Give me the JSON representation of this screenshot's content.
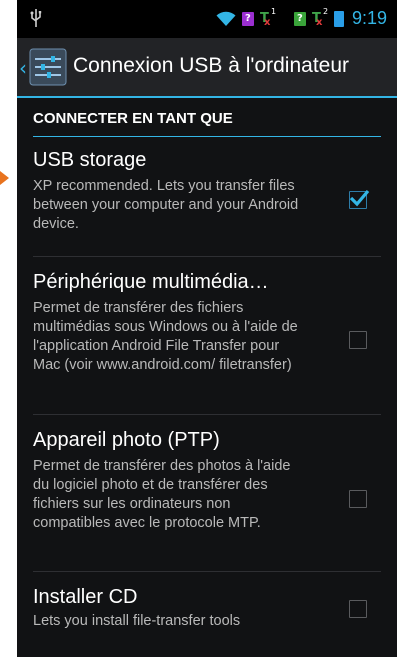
{
  "statusbar": {
    "time": "9:19",
    "sim1_label": "?",
    "sim2_label": "?",
    "signal1_sup": "1",
    "signal2_sup": "2"
  },
  "actionbar": {
    "title": "Connexion USB à l'ordinateur"
  },
  "category": {
    "header": "CONNECTER EN TANT QUE"
  },
  "options": [
    {
      "title": "USB storage",
      "summary": "XP recommended. Lets you transfer files between your computer and your Android device.",
      "checked": true
    },
    {
      "title": "Périphérique multimédia…",
      "summary": "Permet de transférer des fichiers multimédias sous Windows ou à l'aide de l'application Android File Transfer pour Mac (voir www.android.com/ filetransfer)",
      "checked": false
    },
    {
      "title": "Appareil photo (PTP)",
      "summary": "Permet de transférer des photos à l'aide du logiciel photo et de transférer des fichiers sur les ordinateurs non compatibles avec le protocole MTP.",
      "checked": false
    },
    {
      "title": "Installer CD",
      "summary": "Lets you install file-transfer tools",
      "checked": false
    }
  ],
  "colors": {
    "accent": "#33b5e5",
    "marker": "#e8731e"
  }
}
